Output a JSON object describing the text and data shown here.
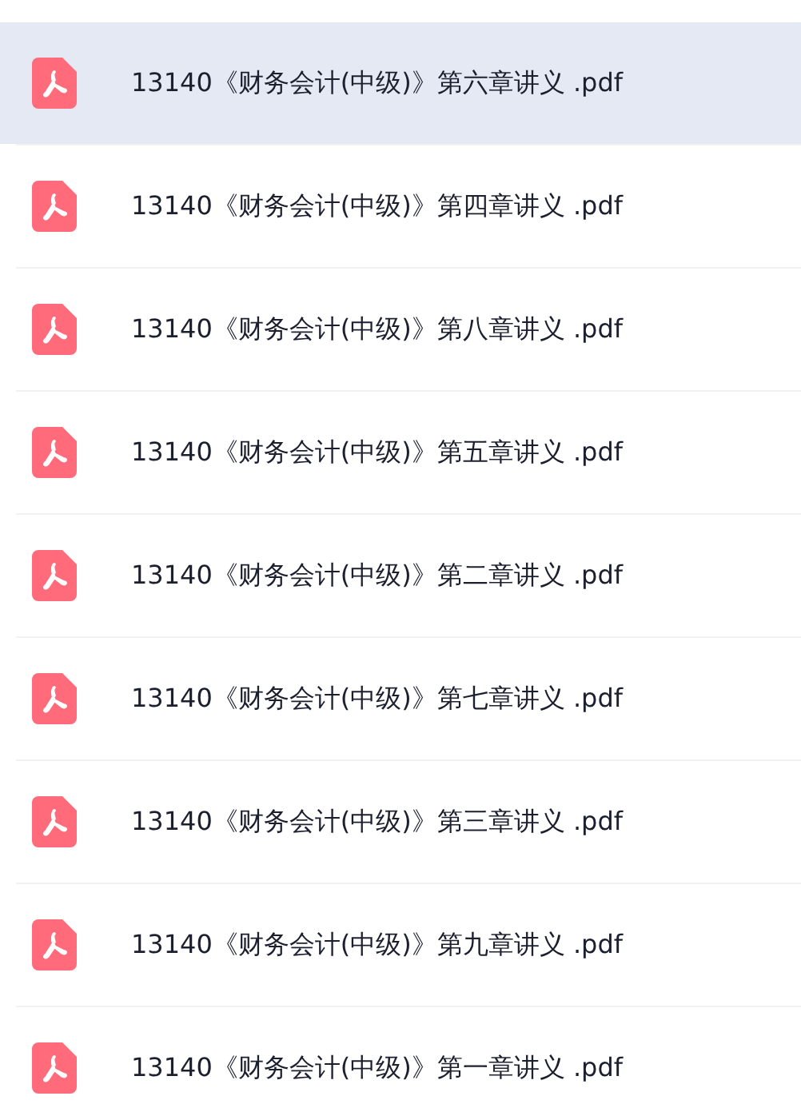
{
  "files": [
    {
      "name": "13140《财务会计(中级)》第六章讲义 .pdf",
      "selected": true
    },
    {
      "name": "13140《财务会计(中级)》第四章讲义 .pdf",
      "selected": false
    },
    {
      "name": "13140《财务会计(中级)》第八章讲义 .pdf",
      "selected": false
    },
    {
      "name": "13140《财务会计(中级)》第五章讲义 .pdf",
      "selected": false
    },
    {
      "name": "13140《财务会计(中级)》第二章讲义 .pdf",
      "selected": false
    },
    {
      "name": "13140《财务会计(中级)》第七章讲义 .pdf",
      "selected": false
    },
    {
      "name": "13140《财务会计(中级)》第三章讲义 .pdf",
      "selected": false
    },
    {
      "name": "13140《财务会计(中级)》第九章讲义 .pdf",
      "selected": false
    },
    {
      "name": "13140《财务会计(中级)》第一章讲义 .pdf",
      "selected": false
    }
  ]
}
